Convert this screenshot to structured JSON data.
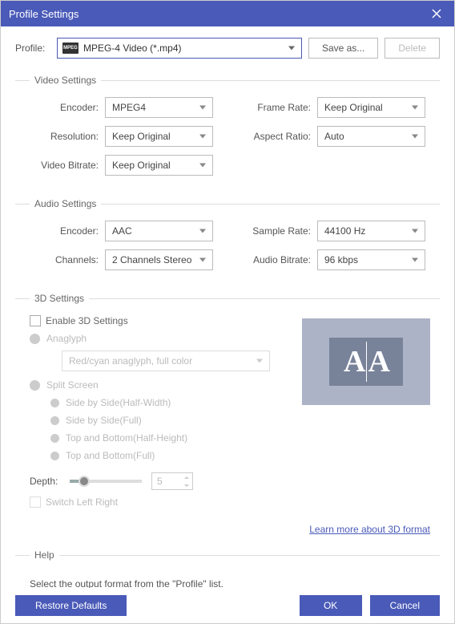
{
  "window": {
    "title": "Profile Settings"
  },
  "profile": {
    "label": "Profile:",
    "value": "MPEG-4 Video (*.mp4)",
    "saveas": "Save as...",
    "delete": "Delete"
  },
  "sections": {
    "video": "Video Settings",
    "audio": "Audio Settings",
    "threed": "3D Settings",
    "help": "Help"
  },
  "video": {
    "encoder_label": "Encoder:",
    "encoder": "MPEG4",
    "framerate_label": "Frame Rate:",
    "framerate": "Keep Original",
    "resolution_label": "Resolution:",
    "resolution": "Keep Original",
    "aspect_label": "Aspect Ratio:",
    "aspect": "Auto",
    "bitrate_label": "Video Bitrate:",
    "bitrate": "Keep Original"
  },
  "audio": {
    "encoder_label": "Encoder:",
    "encoder": "AAC",
    "samplerate_label": "Sample Rate:",
    "samplerate": "44100 Hz",
    "channels_label": "Channels:",
    "channels": "2 Channels Stereo",
    "bitrate_label": "Audio Bitrate:",
    "bitrate": "96 kbps"
  },
  "threed": {
    "enable": "Enable 3D Settings",
    "anaglyph": "Anaglyph",
    "anaglyph_mode": "Red/cyan anaglyph, full color",
    "split": "Split Screen",
    "sbs_half": "Side by Side(Half-Width)",
    "sbs_full": "Side by Side(Full)",
    "tab_half": "Top and Bottom(Half-Height)",
    "tab_full": "Top and Bottom(Full)",
    "depth_label": "Depth:",
    "depth_value": "5",
    "switch_lr": "Switch Left Right",
    "learn_more": "Learn more about 3D format"
  },
  "help": {
    "text": "Select the output format from the \"Profile\" list."
  },
  "footer": {
    "restore": "Restore Defaults",
    "ok": "OK",
    "cancel": "Cancel"
  }
}
